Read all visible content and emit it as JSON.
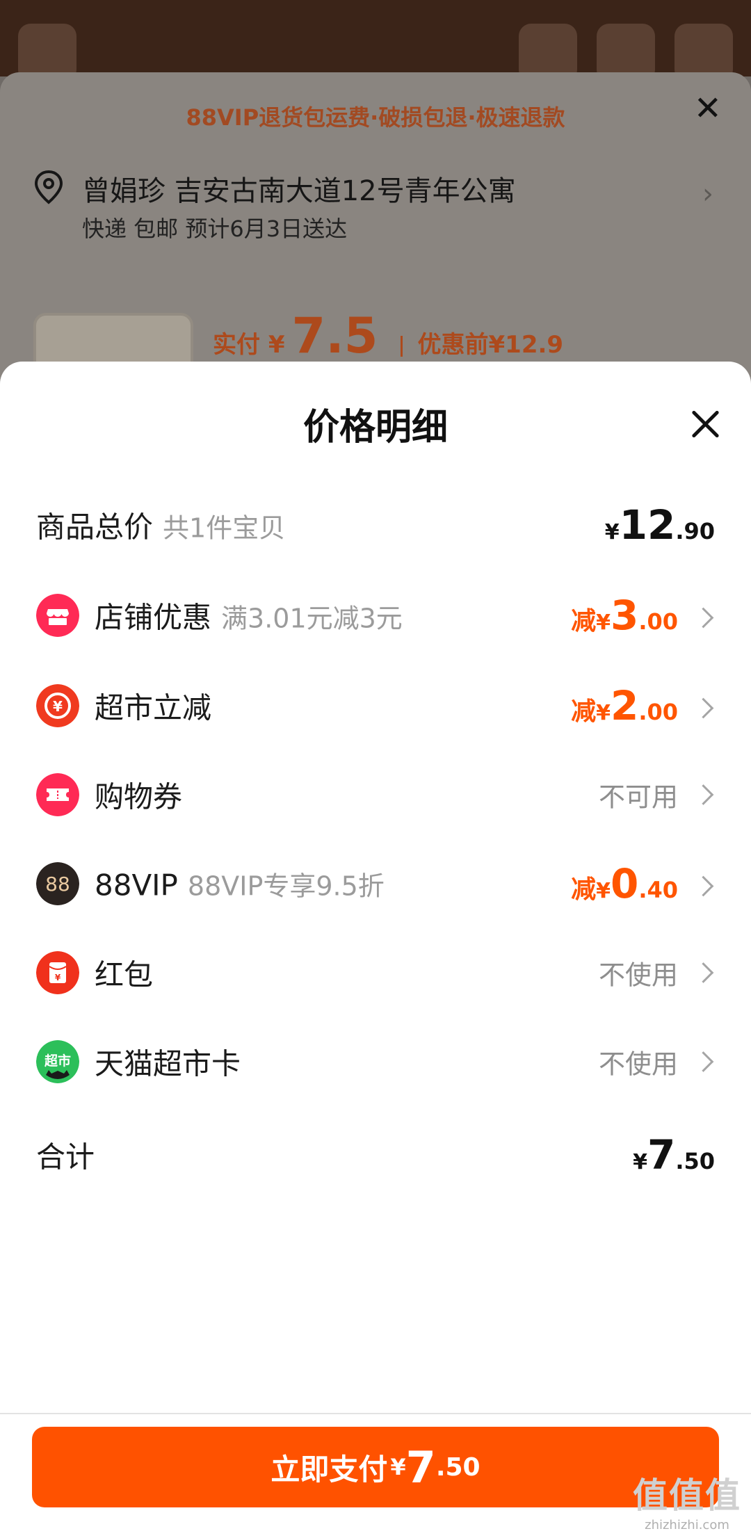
{
  "background": {
    "banner": "88VIP退货包运费·破损包退·极速退款",
    "address": {
      "name_line": "曾娟珍 吉安古南大道12号青年公寓",
      "delivery_line": "快递 包邮 预计6月3日送达"
    },
    "price": {
      "paid_label": "实付 ¥",
      "paid_value": "7.5",
      "original_label": "优惠前¥12.9"
    }
  },
  "sheet": {
    "title": "价格明细",
    "total_row": {
      "label": "商品总价",
      "sub": "共1件宝贝",
      "yen": "¥",
      "int": "12",
      "dec": ".90"
    },
    "rows": [
      {
        "label": "店铺优惠",
        "sub": "满3.01元减3元",
        "prefix": "减",
        "yen": "¥",
        "int": "3",
        "dec": ".00",
        "icon": "shop-icon",
        "color": "#ff2a55"
      },
      {
        "label": "超市立减",
        "sub": "",
        "prefix": "减",
        "yen": "¥",
        "int": "2",
        "dec": ".00",
        "icon": "yen-refresh-icon",
        "color": "#f03a1f"
      },
      {
        "label": "购物券",
        "sub": "",
        "status": "不可用",
        "icon": "coupon-icon",
        "color": "#ff2a55"
      },
      {
        "label": "88VIP",
        "sub": "88VIP专享9.5折",
        "prefix": "减",
        "yen": "¥",
        "int": "0",
        "dec": ".40",
        "icon": "88vip-icon",
        "color": "#2a2320"
      },
      {
        "label": "红包",
        "sub": "",
        "status": "不使用",
        "icon": "red-packet-icon",
        "color": "#f0311c"
      },
      {
        "label": "天猫超市卡",
        "sub": "",
        "status": "不使用",
        "icon": "tmall-supermarket-icon",
        "color": "#2cbf5a",
        "icon_text": "超市"
      }
    ],
    "sum_row": {
      "label": "合计",
      "yen": "¥",
      "int": "7",
      "dec": ".50"
    },
    "pay_button": {
      "label": "立即支付",
      "yen": "¥",
      "int": "7",
      "dec": ".50"
    }
  },
  "watermark": {
    "top": "值值值",
    "bottom": "zhizhizhi.com"
  },
  "colors": {
    "accent": "#ff5500",
    "button": "#ff5200"
  }
}
